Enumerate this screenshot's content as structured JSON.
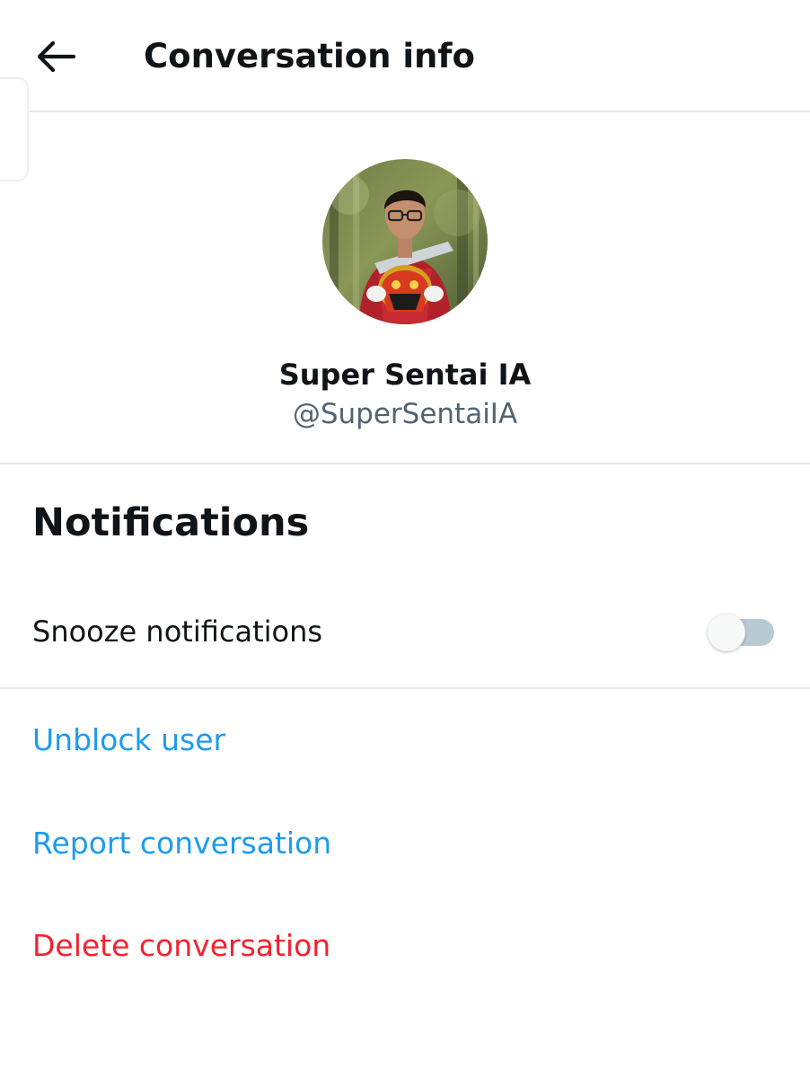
{
  "header": {
    "title": "Conversation info",
    "back_icon": "arrow-left-icon"
  },
  "profile": {
    "name": "Super Sentai IA",
    "handle": "@SuperSentaiIA",
    "avatar_description": "avatar photo"
  },
  "notifications": {
    "title": "Notifications",
    "snooze_label": "Snooze notifications",
    "snooze_enabled": false
  },
  "actions": {
    "unblock_label": "Unblock user",
    "report_label": "Report conversation",
    "delete_label": "Delete conversation"
  },
  "colors": {
    "link": "#1d9bf0",
    "danger": "#f4212e",
    "secondary_text": "#536471",
    "toggle_track": "#b9cad3"
  }
}
